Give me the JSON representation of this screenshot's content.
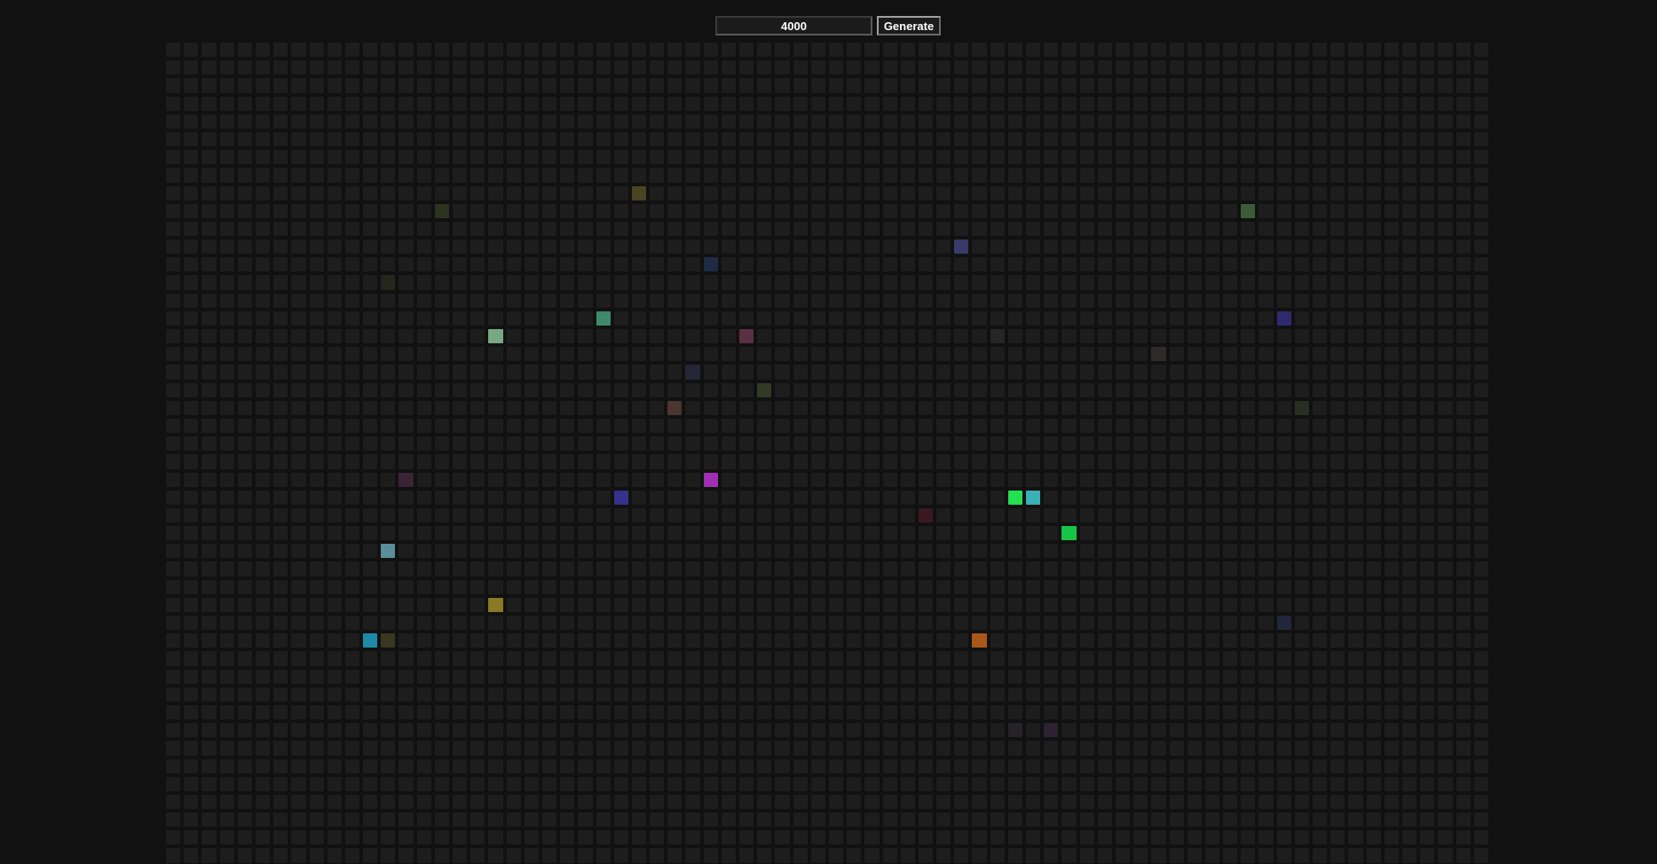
{
  "controls": {
    "count_value": "4000",
    "generate_label": "Generate"
  },
  "grid": {
    "columns": 74,
    "rows": 46,
    "base_color": "#1d1d1d",
    "lit_cells": [
      {
        "row": 8,
        "col": 26,
        "color": "#4a4424"
      },
      {
        "row": 9,
        "col": 15,
        "color": "#2e3320"
      },
      {
        "row": 9,
        "col": 60,
        "color": "#3d5a3a"
      },
      {
        "row": 11,
        "col": 44,
        "color": "#3a3a6a"
      },
      {
        "row": 12,
        "col": 30,
        "color": "#1f2a44"
      },
      {
        "row": 13,
        "col": 12,
        "color": "#25271e"
      },
      {
        "row": 15,
        "col": 24,
        "color": "#3f8a6c"
      },
      {
        "row": 15,
        "col": 62,
        "color": "#2f2a6e"
      },
      {
        "row": 16,
        "col": 18,
        "color": "#79a983"
      },
      {
        "row": 16,
        "col": 32,
        "color": "#5a2f45"
      },
      {
        "row": 16,
        "col": 46,
        "color": "#262626"
      },
      {
        "row": 17,
        "col": 55,
        "color": "#2e2a2a"
      },
      {
        "row": 18,
        "col": 29,
        "color": "#262636"
      },
      {
        "row": 19,
        "col": 33,
        "color": "#313a26"
      },
      {
        "row": 20,
        "col": 28,
        "color": "#4a3530"
      },
      {
        "row": 20,
        "col": 63,
        "color": "#282e22"
      },
      {
        "row": 24,
        "col": 13,
        "color": "#3a2436"
      },
      {
        "row": 24,
        "col": 30,
        "color": "#a02fb5"
      },
      {
        "row": 25,
        "col": 25,
        "color": "#36328a"
      },
      {
        "row": 25,
        "col": 47,
        "color": "#22e04f"
      },
      {
        "row": 25,
        "col": 48,
        "color": "#3bb0b8"
      },
      {
        "row": 26,
        "col": 42,
        "color": "#3a1a20"
      },
      {
        "row": 27,
        "col": 50,
        "color": "#18c445"
      },
      {
        "row": 28,
        "col": 12,
        "color": "#5a8e9a"
      },
      {
        "row": 31,
        "col": 18,
        "color": "#8a7a26"
      },
      {
        "row": 32,
        "col": 62,
        "color": "#22263a"
      },
      {
        "row": 33,
        "col": 11,
        "color": "#1e8aa8"
      },
      {
        "row": 33,
        "col": 12,
        "color": "#3a3620"
      },
      {
        "row": 33,
        "col": 45,
        "color": "#a85818"
      },
      {
        "row": 38,
        "col": 47,
        "color": "#262226"
      },
      {
        "row": 38,
        "col": 49,
        "color": "#2e2232"
      }
    ]
  }
}
